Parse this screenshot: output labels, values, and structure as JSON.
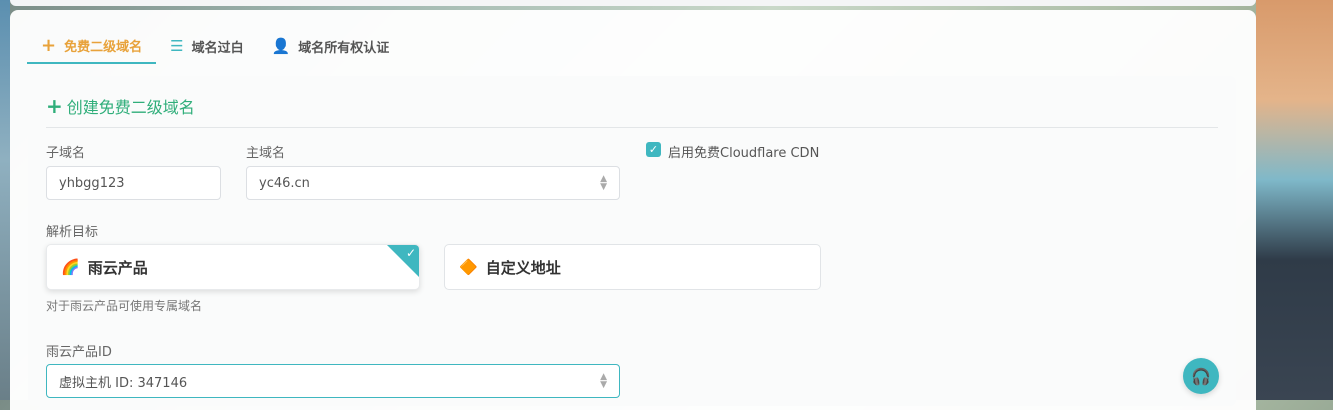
{
  "tabs": [
    {
      "label": "免费二级域名",
      "icon": "plus-icon",
      "active": true
    },
    {
      "label": "域名过白",
      "icon": "list-icon",
      "active": false
    },
    {
      "label": "域名所有权认证",
      "icon": "user-icon",
      "active": false
    }
  ],
  "form": {
    "title": "创建免费二级域名",
    "subdomain": {
      "label": "子域名",
      "value": "yhbgg123"
    },
    "main_domain": {
      "label": "主域名",
      "value": "yc46.cn"
    },
    "cdn": {
      "label": "启用免费Cloudflare CDN",
      "checked": true
    },
    "target": {
      "label": "解析目标",
      "options": [
        {
          "label": "雨云产品",
          "icon": "rainbow-icon",
          "selected": true
        },
        {
          "label": "自定义地址",
          "icon": "custom-icon",
          "selected": false
        }
      ],
      "hint": "对于雨云产品可使用专属域名"
    },
    "product_id": {
      "label": "雨云产品ID",
      "value": "虚拟主机 ID: 347146"
    }
  },
  "support": {
    "icon": "headset-icon"
  },
  "colors": {
    "accent": "#3fb7c0",
    "active_tab": "#e8a23a",
    "title_green": "#2fae7a"
  }
}
